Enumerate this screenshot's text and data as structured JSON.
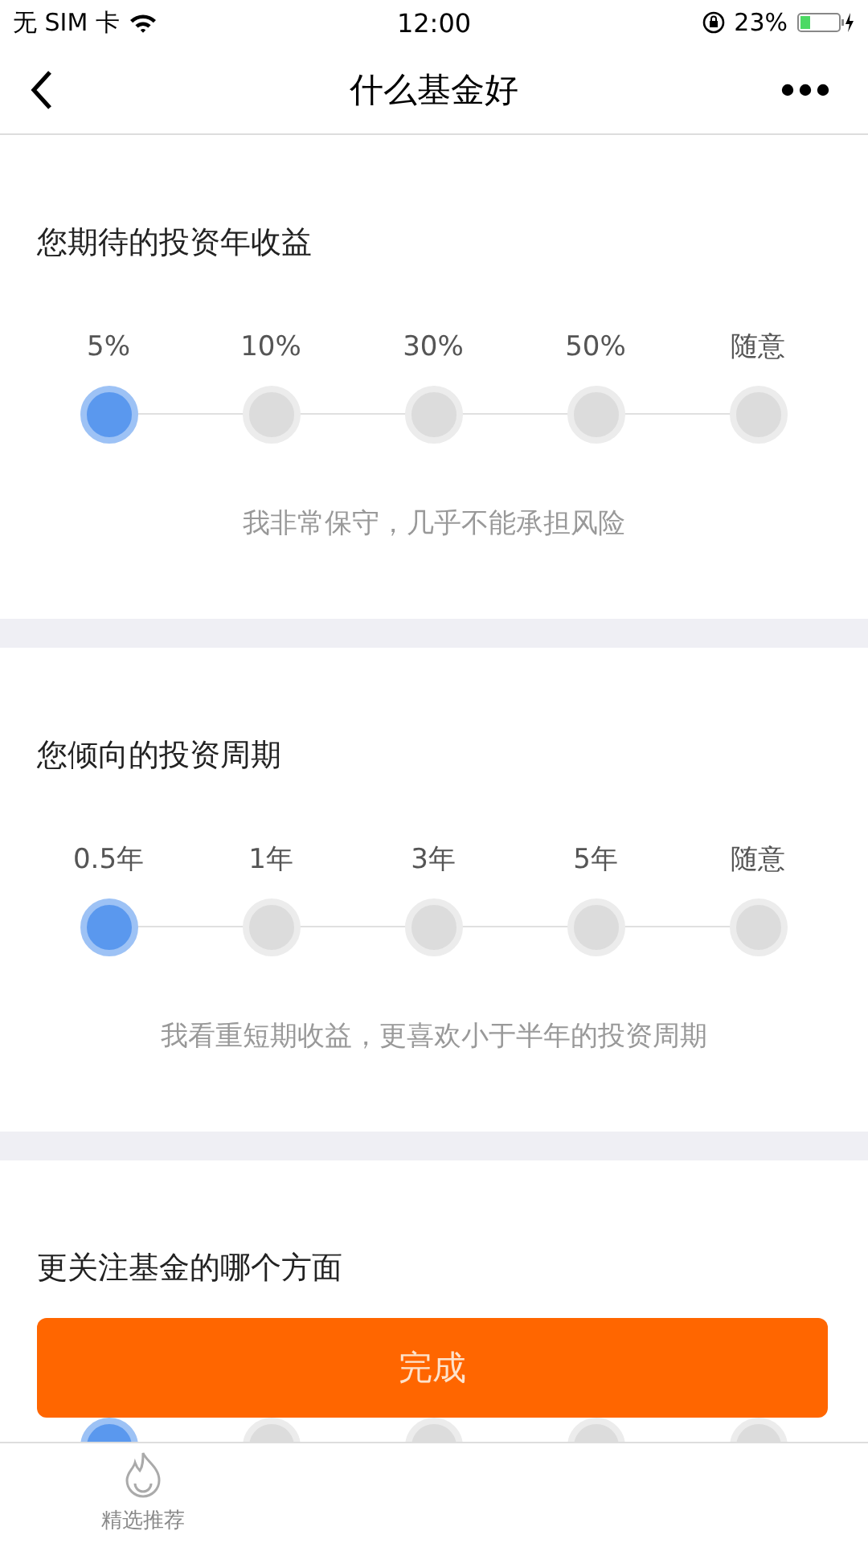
{
  "status_bar": {
    "carrier": "无 SIM 卡",
    "time": "12:00",
    "battery": "23%"
  },
  "nav": {
    "title": "什么基金好"
  },
  "sections": [
    {
      "title": "您期待的投资年收益",
      "options": [
        {
          "label": "5%",
          "selected": true
        },
        {
          "label": "10%",
          "selected": false
        },
        {
          "label": "30%",
          "selected": false
        },
        {
          "label": "50%",
          "selected": false
        },
        {
          "label": "随意",
          "selected": false
        }
      ],
      "description": "我非常保守，几乎不能承担风险"
    },
    {
      "title": "您倾向的投资周期",
      "options": [
        {
          "label": "0.5年",
          "selected": true
        },
        {
          "label": "1年",
          "selected": false
        },
        {
          "label": "3年",
          "selected": false
        },
        {
          "label": "5年",
          "selected": false
        },
        {
          "label": "随意",
          "selected": false
        }
      ],
      "description": "我看重短期收益，更喜欢小于半年的投资周期"
    },
    {
      "title": "更关注基金的哪个方面",
      "options": [
        {
          "selected": true
        },
        {
          "selected": false
        },
        {
          "selected": false
        },
        {
          "selected": false
        },
        {
          "selected": false
        }
      ]
    }
  ],
  "button": "完成",
  "tab_bar": [
    {
      "label": "精选推荐"
    }
  ]
}
